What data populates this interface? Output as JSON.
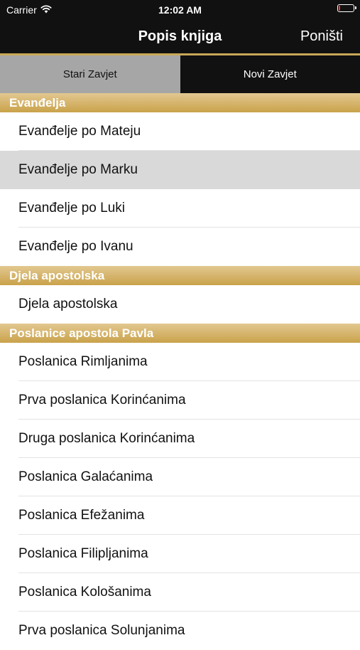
{
  "status": {
    "carrier": "Carrier",
    "time": "12:02 AM",
    "battery_percent": 10,
    "battery_color": "#ff3b30"
  },
  "nav": {
    "title": "Popis knjiga",
    "cancel_label": "Poništi"
  },
  "segments": [
    {
      "label": "Stari Zavjet",
      "selected": false
    },
    {
      "label": "Novi Zavjet",
      "selected": true
    }
  ],
  "colors": {
    "gold": "#c9a24a",
    "bar": "#111111",
    "selected_row": "#d9d9d9"
  },
  "sections": [
    {
      "title": "Evanđelja",
      "items": [
        "Evanđelje po Mateju",
        "Evanđelje po Marku",
        "Evanđelje po Luki",
        "Evanđelje po Ivanu"
      ]
    },
    {
      "title": "Djela apostolska",
      "items": [
        "Djela apostolska"
      ]
    },
    {
      "title": "Poslanice apostola Pavla",
      "items": [
        "Poslanica Rimljanima",
        "Prva poslanica Korinćanima",
        "Druga poslanica Korinćanima",
        "Poslanica Galaćanima",
        "Poslanica Efežanima",
        "Poslanica Filipljanima",
        "Poslanica Kološanima",
        "Prva poslanica Solunjanima"
      ]
    }
  ],
  "selected_item": "Evanđelje po Marku"
}
